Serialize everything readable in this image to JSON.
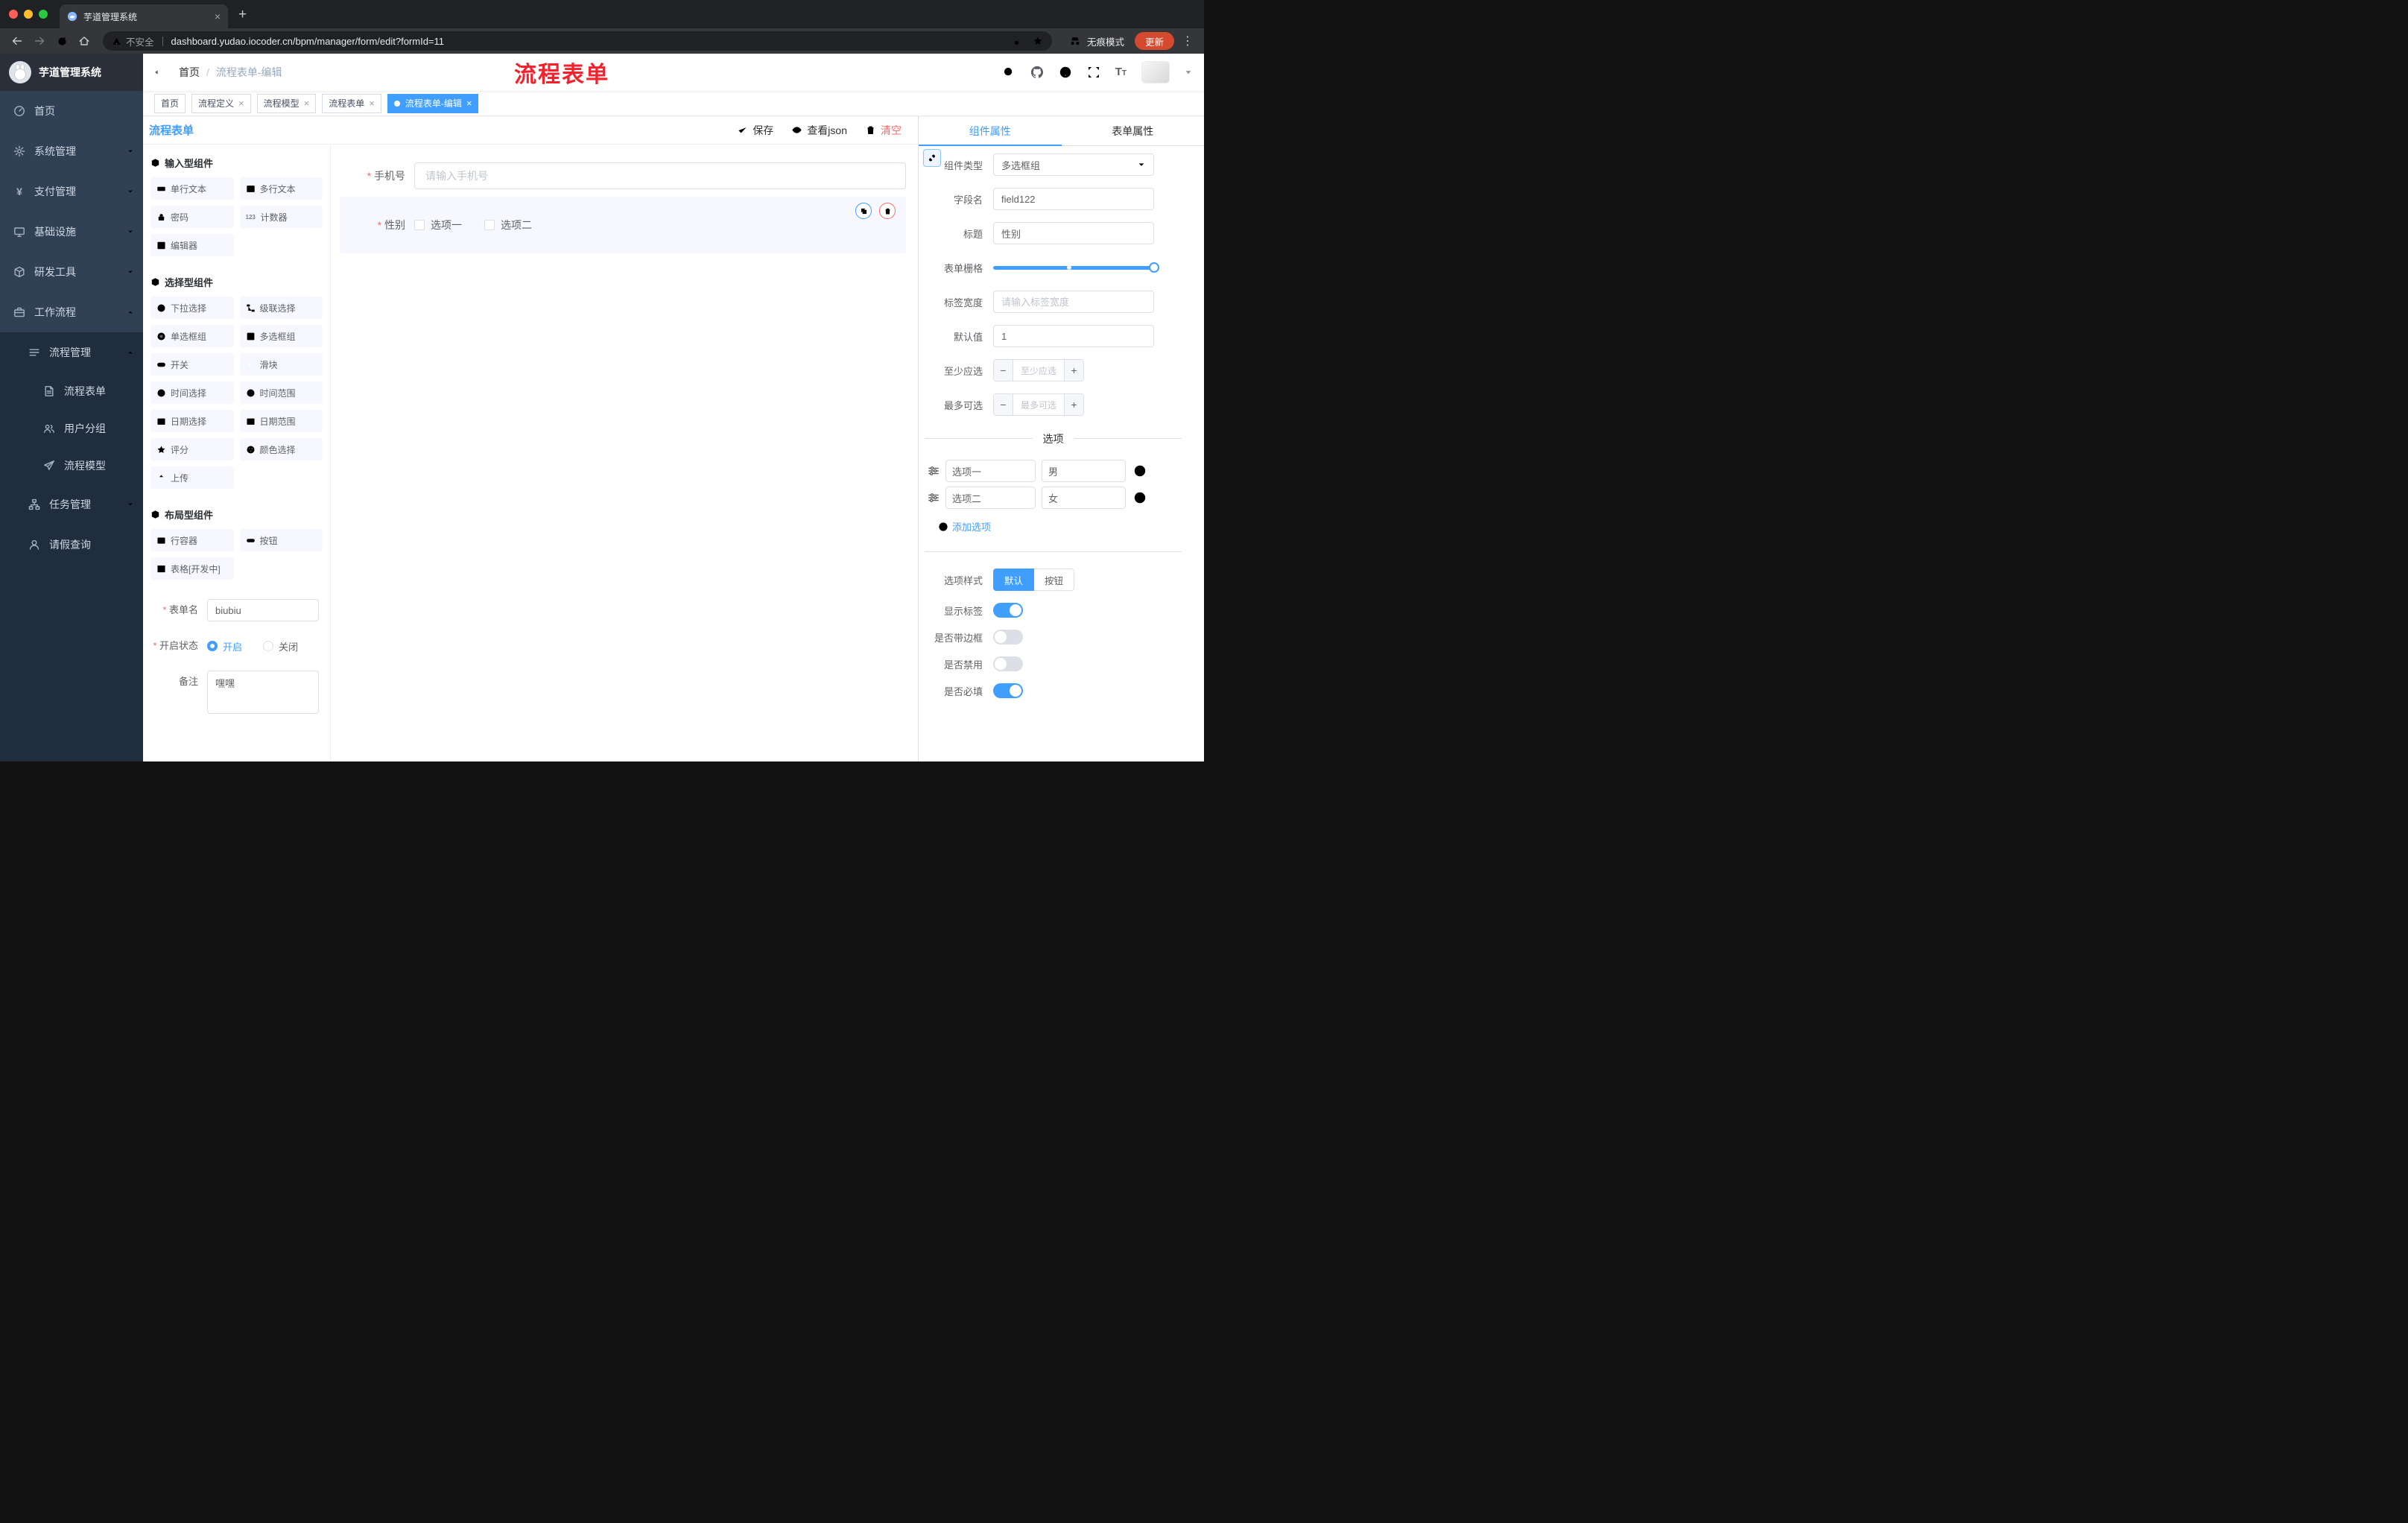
{
  "colors": {
    "primary": "#409eff",
    "danger": "#f56c6c",
    "annotation_red": "#f5222d",
    "update_badge": "#d5492f",
    "sidebar_bg": "#304156",
    "submenu_bg": "#1f2d3d",
    "active_tag": "#409eff"
  },
  "glyphs": {
    "close": "×",
    "plus": "+",
    "dots": "⋮",
    "yen": "¥",
    "counter": "123",
    "font_big": "T",
    "font_small": "T"
  },
  "browser": {
    "tab_title": "芋道管理系统",
    "security_label": "不安全",
    "url": "dashboard.yudao.iocoder.cn/bpm/manager/form/edit?formId=11",
    "incognito_label": "无痕模式",
    "update_label": "更新"
  },
  "annotation": {
    "text": "流程表单"
  },
  "sidebar": {
    "logo_title": "芋道管理系统",
    "menu": [
      {
        "label": "首页",
        "icon": "dashboard-icon"
      },
      {
        "label": "系统管理",
        "icon": "gear-icon",
        "expand": "down"
      },
      {
        "label": "支付管理",
        "icon": "yen-icon",
        "expand": "down"
      },
      {
        "label": "基础设施",
        "icon": "monitor-icon",
        "expand": "down"
      },
      {
        "label": "研发工具",
        "icon": "box-icon",
        "expand": "down"
      },
      {
        "label": "工作流程",
        "icon": "briefcase-icon",
        "expand": "up"
      }
    ],
    "submenu": [
      {
        "label": "流程管理",
        "icon": "list-icon",
        "expand": "up"
      },
      {
        "label": "流程表单",
        "icon": "document-icon"
      },
      {
        "label": "用户分组",
        "icon": "users-icon"
      },
      {
        "label": "流程模型",
        "icon": "send-icon"
      },
      {
        "label": "任务管理",
        "icon": "tree-icon",
        "exp": "down"
      },
      {
        "label": "请假查询",
        "icon": "user-icon"
      }
    ]
  },
  "navbar": {
    "breadcrumb": {
      "home": "首页",
      "sep": "/",
      "current": "流程表单-编辑"
    }
  },
  "tags": {
    "items": [
      {
        "label": "首页",
        "closable": false,
        "active": false
      },
      {
        "label": "流程定义",
        "closable": true,
        "active": false
      },
      {
        "label": "流程模型",
        "closable": true,
        "active": false
      },
      {
        "label": "流程表单",
        "closable": true,
        "active": false
      },
      {
        "label": "流程表单-编辑",
        "closable": true,
        "active": true
      }
    ]
  },
  "editor": {
    "title": "流程表单",
    "actions": {
      "save": "保存",
      "view_json": "查看json",
      "clear": "清空"
    }
  },
  "palette": {
    "counter_icon": "123",
    "sections": [
      {
        "title": "输入型组件",
        "items": [
          {
            "label": "单行文本",
            "icon": "text-line-icon"
          },
          {
            "label": "多行文本",
            "icon": "textarea-icon"
          },
          {
            "label": "密码",
            "icon": "lock-icon"
          },
          {
            "label": "计数器",
            "icon": "counter-icon"
          },
          {
            "label": "编辑器",
            "icon": "editor-icon"
          }
        ]
      },
      {
        "title": "选择型组件",
        "items": [
          {
            "label": "下拉选择",
            "icon": "select-icon"
          },
          {
            "label": "级联选择",
            "icon": "cascader-icon"
          },
          {
            "label": "单选框组",
            "icon": "radio-icon"
          },
          {
            "label": "多选框组",
            "icon": "checkbox-icon"
          },
          {
            "label": "开关",
            "icon": "switch-icon"
          },
          {
            "label": "滑块",
            "icon": "slider-icon"
          },
          {
            "label": "时间选择",
            "icon": "clock-icon"
          },
          {
            "label": "时间范围",
            "icon": "clock-icon"
          },
          {
            "label": "日期选择",
            "icon": "calendar-icon"
          },
          {
            "label": "日期范围",
            "icon": "calendar-icon"
          },
          {
            "label": "评分",
            "icon": "star-icon"
          },
          {
            "label": "颜色选择",
            "icon": "color-icon"
          },
          {
            "label": "上传",
            "icon": "upload-icon"
          }
        ]
      },
      {
        "title": "布局型组件",
        "items": [
          {
            "label": "行容器",
            "icon": "row-icon"
          },
          {
            "label": "按钮",
            "icon": "button-icon"
          },
          {
            "label": "表格[开发中]",
            "icon": "table-icon"
          }
        ]
      }
    ]
  },
  "form_meta": {
    "name_label": "表单名",
    "name_value": "biubiu",
    "status_label": "开启状态",
    "status_on": "开启",
    "status_off": "关闭",
    "status_value": "开启",
    "remark_label": "备注",
    "remark_value": "嘿嘿"
  },
  "canvas": {
    "phone_label": "手机号",
    "phone_placeholder": "请输入手机号",
    "gender_label": "性别",
    "gender_options": [
      "选项一",
      "选项二"
    ]
  },
  "props": {
    "tab_component": "组件属性",
    "tab_form": "表单属性",
    "component_type_label": "组件类型",
    "component_type_value": "多选框组",
    "field_name_label": "字段名",
    "field_name_value": "field122",
    "title_label": "标题",
    "title_value": "性别",
    "grid_label": "表单栅格",
    "label_width_label": "标签宽度",
    "label_width_placeholder": "请输入标签宽度",
    "default_label": "默认值",
    "default_value": "1",
    "min_label": "至少应选",
    "min_placeholder": "至少应选",
    "max_label": "最多可选",
    "max_placeholder": "最多可选",
    "options_title": "选项",
    "options": [
      {
        "label": "选项一",
        "value": "男"
      },
      {
        "label": "选项二",
        "value": "女"
      }
    ],
    "add_option": "添加选项",
    "style_label": "选项样式",
    "style_default": "默认",
    "style_button": "按钮",
    "switches": [
      {
        "label": "显示标签",
        "on": true
      },
      {
        "label": "是否带边框",
        "on": false
      },
      {
        "label": "是否禁用",
        "on": false
      },
      {
        "label": "是否必填",
        "on": true
      }
    ]
  }
}
